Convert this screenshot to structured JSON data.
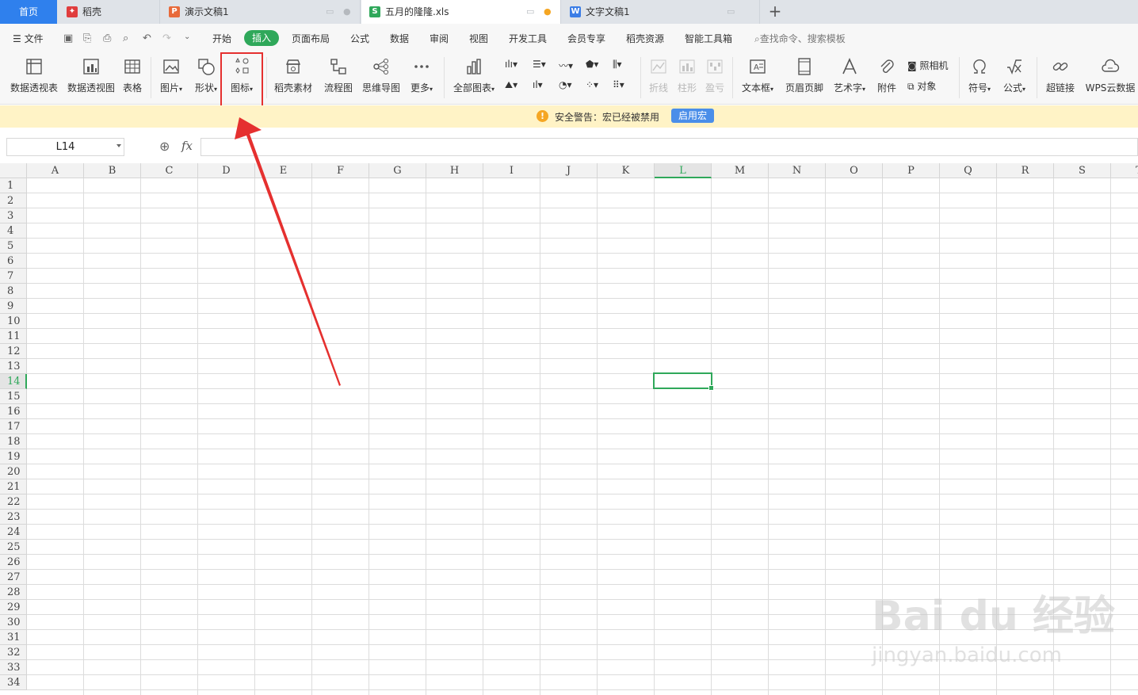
{
  "tabs": {
    "home": "首页",
    "items": [
      {
        "label": "稻壳",
        "icon": "daoke-icon",
        "color": "#e03d3d"
      },
      {
        "label": "演示文稿1",
        "icon": "presentation-icon",
        "color": "#e86a3a"
      },
      {
        "label": "五月的隆隆.xls",
        "icon": "spreadsheet-icon",
        "color": "#2fa85a"
      },
      {
        "label": "文字文稿1",
        "icon": "word-icon",
        "color": "#3b7de6"
      }
    ],
    "add": "+"
  },
  "menu": {
    "file": "文件",
    "items": [
      "开始",
      "插入",
      "页面布局",
      "公式",
      "数据",
      "审阅",
      "视图",
      "开发工具",
      "会员专享",
      "稻壳资源",
      "智能工具箱"
    ],
    "active": "插入",
    "search": "查找命令、搜索模板"
  },
  "ribbon": {
    "pivot_table": "数据透视表",
    "pivot_chart": "数据透视图",
    "table": "表格",
    "picture": "图片",
    "shape": "形状",
    "icon": "图标",
    "daoke_material": "稻壳素材",
    "flowchart": "流程图",
    "mindmap": "思维导图",
    "more": "更多",
    "all_charts": "全部图表",
    "sparkline_line": "折线",
    "sparkline_column": "柱形",
    "sparkline_winloss": "盈亏",
    "textbox": "文本框",
    "header_footer": "页眉页脚",
    "wordart": "艺术字",
    "attachment": "附件",
    "camera": "照相机",
    "object": "对象",
    "symbol": "符号",
    "formula": "公式",
    "hyperlink": "超链接",
    "wps_cloud": "WPS云数据"
  },
  "warning": {
    "text": "安全警告：宏已经被禁用",
    "button": "启用宏"
  },
  "formula_bar": {
    "cell_ref": "L14",
    "fx": "fx",
    "value": ""
  },
  "sheet": {
    "columns": [
      "A",
      "B",
      "C",
      "D",
      "E",
      "F",
      "G",
      "H",
      "I",
      "J",
      "K",
      "L",
      "M",
      "N",
      "O",
      "P",
      "Q",
      "R",
      "S",
      "T"
    ],
    "rows": [
      "1",
      "2",
      "3",
      "4",
      "5",
      "6",
      "7",
      "8",
      "9",
      "10",
      "11",
      "12",
      "13",
      "14",
      "15",
      "16",
      "17",
      "18",
      "19",
      "20",
      "21",
      "22",
      "23",
      "24",
      "25",
      "26",
      "27",
      "28",
      "29",
      "30",
      "31",
      "32",
      "33",
      "34"
    ],
    "selected_col": "L",
    "selected_row": "14"
  },
  "watermark": {
    "brand": "Bai du 经验",
    "url": "jingyan.baidu.com"
  },
  "colors": {
    "accent": "#2fa85a",
    "highlight": "#e5302f"
  }
}
